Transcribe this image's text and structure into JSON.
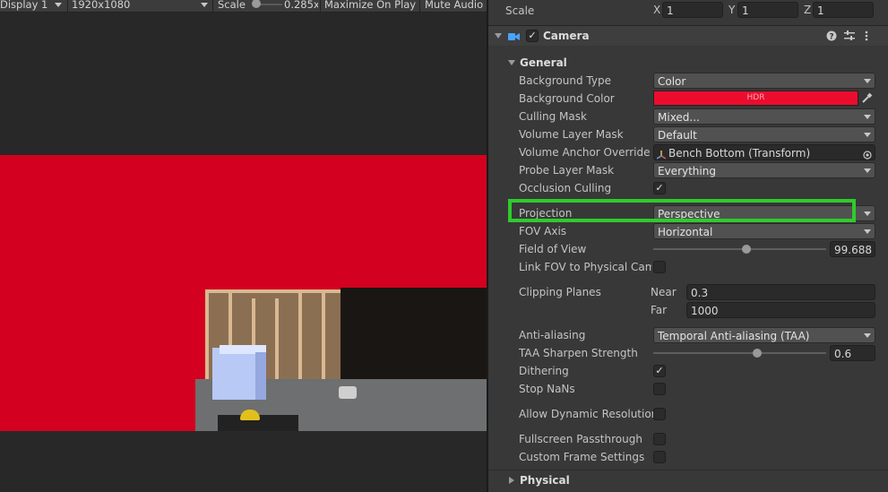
{
  "game_toolbar": {
    "display": "Display 1",
    "resolution": "1920x1080",
    "scale_label": "Scale",
    "scale_value": "0.285x",
    "maximize": "Maximize On Play",
    "mute": "Mute Audio"
  },
  "transform": {
    "scale_label": "Scale",
    "x_label": "X",
    "x": "1",
    "y_label": "Y",
    "y": "1",
    "z_label": "Z",
    "z": "1"
  },
  "camera": {
    "title": "Camera",
    "enabled": true,
    "icons": [
      "help-icon",
      "preset-icon",
      "more-menu-icon"
    ],
    "general_label": "General",
    "physical_label": "Physical",
    "rows": {
      "background_type": {
        "label": "Background Type",
        "value": "Color"
      },
      "background_color": {
        "label": "Background Color",
        "color": "#ec0d2e",
        "hdr": "HDR"
      },
      "culling_mask": {
        "label": "Culling Mask",
        "value": "Mixed..."
      },
      "volume_layer_mask": {
        "label": "Volume Layer Mask",
        "value": "Default"
      },
      "volume_anchor_override": {
        "label": "Volume Anchor Override",
        "value": "Bench Bottom (Transform)"
      },
      "probe_layer_mask": {
        "label": "Probe Layer Mask",
        "value": "Everything"
      },
      "occlusion_culling": {
        "label": "Occlusion Culling",
        "checked": true
      },
      "projection": {
        "label": "Projection",
        "value": "Perspective"
      },
      "fov_axis": {
        "label": "FOV Axis",
        "value": "Horizontal"
      },
      "field_of_view": {
        "label": "Field of View",
        "value": "99.688",
        "fraction": 0.54
      },
      "link_fov": {
        "label": "Link FOV to Physical Came",
        "checked": false
      },
      "clipping_planes": {
        "label": "Clipping Planes",
        "near_label": "Near",
        "near": "0.3",
        "far_label": "Far",
        "far": "1000"
      },
      "anti_aliasing": {
        "label": "Anti-aliasing",
        "value": "Temporal Anti-aliasing (TAA)"
      },
      "taa_sharpen": {
        "label": "TAA Sharpen Strength",
        "value": "0.6",
        "fraction": 0.6
      },
      "dithering": {
        "label": "Dithering",
        "checked": true
      },
      "stop_nans": {
        "label": "Stop NaNs",
        "checked": false
      },
      "allow_dynamic_resolution": {
        "label": "Allow Dynamic Resolution",
        "checked": false
      },
      "fullscreen_passthrough": {
        "label": "Fullscreen Passthrough",
        "checked": false
      },
      "custom_frame_settings": {
        "label": "Custom Frame Settings",
        "checked": false
      }
    }
  },
  "colors": {
    "viewport_background": "#d4001f",
    "highlight": "#2fcb2c",
    "accent_camera_icon": "#4aa3ff"
  }
}
